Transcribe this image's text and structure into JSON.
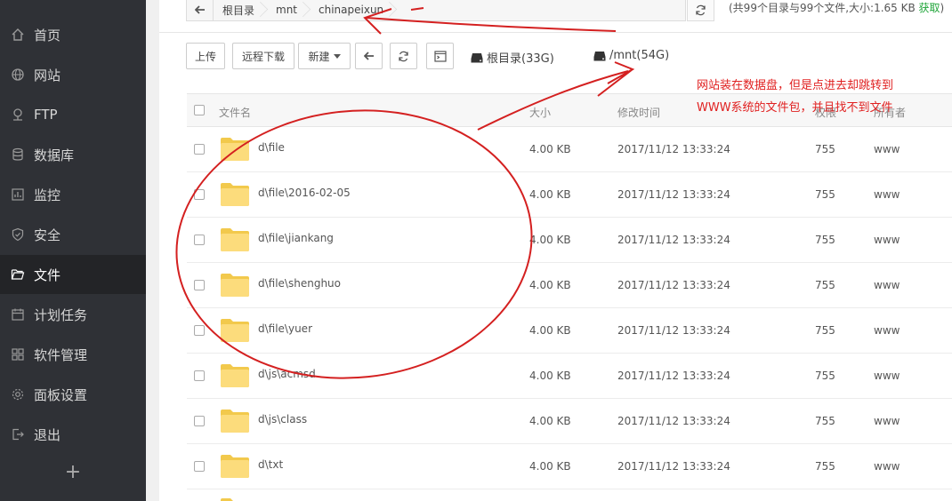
{
  "sidebar": {
    "items": [
      {
        "label": "首页",
        "icon": "home-icon"
      },
      {
        "label": "网站",
        "icon": "globe-icon"
      },
      {
        "label": "FTP",
        "icon": "ftp-icon"
      },
      {
        "label": "数据库",
        "icon": "database-icon"
      },
      {
        "label": "监控",
        "icon": "monitor-icon"
      },
      {
        "label": "安全",
        "icon": "shield-icon"
      },
      {
        "label": "文件",
        "icon": "folder-icon",
        "active": true
      },
      {
        "label": "计划任务",
        "icon": "calendar-icon"
      },
      {
        "label": "软件管理",
        "icon": "grid-icon"
      },
      {
        "label": "面板设置",
        "icon": "gear-icon"
      },
      {
        "label": "退出",
        "icon": "logout-icon"
      }
    ],
    "add_label": "+"
  },
  "path": {
    "crumbs": [
      "根目录",
      "mnt",
      "chinapeixun"
    ]
  },
  "summary": {
    "text": "(共99个目录与99个文件,大小:1.65 KB ",
    "link": "获取",
    "close": ")"
  },
  "toolbar": {
    "upload": "上传",
    "remote_download": "远程下载",
    "new": "新建",
    "disks": [
      "根目录(33G)",
      "/mnt(54G)"
    ]
  },
  "annotation": {
    "line1": "网站装在数据盘，但是点进去却跳转到",
    "line2": "WWW系统的文件包，并且找不到文件"
  },
  "table": {
    "headers": {
      "name": "文件名",
      "size": "大小",
      "mtime": "修改时间",
      "perm": "权限",
      "owner": "所有者"
    },
    "rows": [
      {
        "name": "d\\file",
        "size": "4.00 KB",
        "mtime": "2017/11/12 13:33:24",
        "perm": "755",
        "owner": "www"
      },
      {
        "name": "d\\file\\2016-02-05",
        "size": "4.00 KB",
        "mtime": "2017/11/12 13:33:24",
        "perm": "755",
        "owner": "www"
      },
      {
        "name": "d\\file\\jiankang",
        "size": "4.00 KB",
        "mtime": "2017/11/12 13:33:24",
        "perm": "755",
        "owner": "www"
      },
      {
        "name": "d\\file\\shenghuo",
        "size": "4.00 KB",
        "mtime": "2017/11/12 13:33:24",
        "perm": "755",
        "owner": "www"
      },
      {
        "name": "d\\file\\yuer",
        "size": "4.00 KB",
        "mtime": "2017/11/12 13:33:24",
        "perm": "755",
        "owner": "www"
      },
      {
        "name": "d\\js\\acmsd",
        "size": "4.00 KB",
        "mtime": "2017/11/12 13:33:24",
        "perm": "755",
        "owner": "www"
      },
      {
        "name": "d\\js\\class",
        "size": "4.00 KB",
        "mtime": "2017/11/12 13:33:24",
        "perm": "755",
        "owner": "www"
      },
      {
        "name": "d\\txt",
        "size": "4.00 KB",
        "mtime": "2017/11/12 13:33:24",
        "perm": "755",
        "owner": "www"
      }
    ]
  },
  "colors": {
    "sidebar_bg": "#2f3136",
    "accent_green": "#20a53a",
    "annotation_red": "#e02020",
    "folder_yellow": "#fcdc7c"
  }
}
